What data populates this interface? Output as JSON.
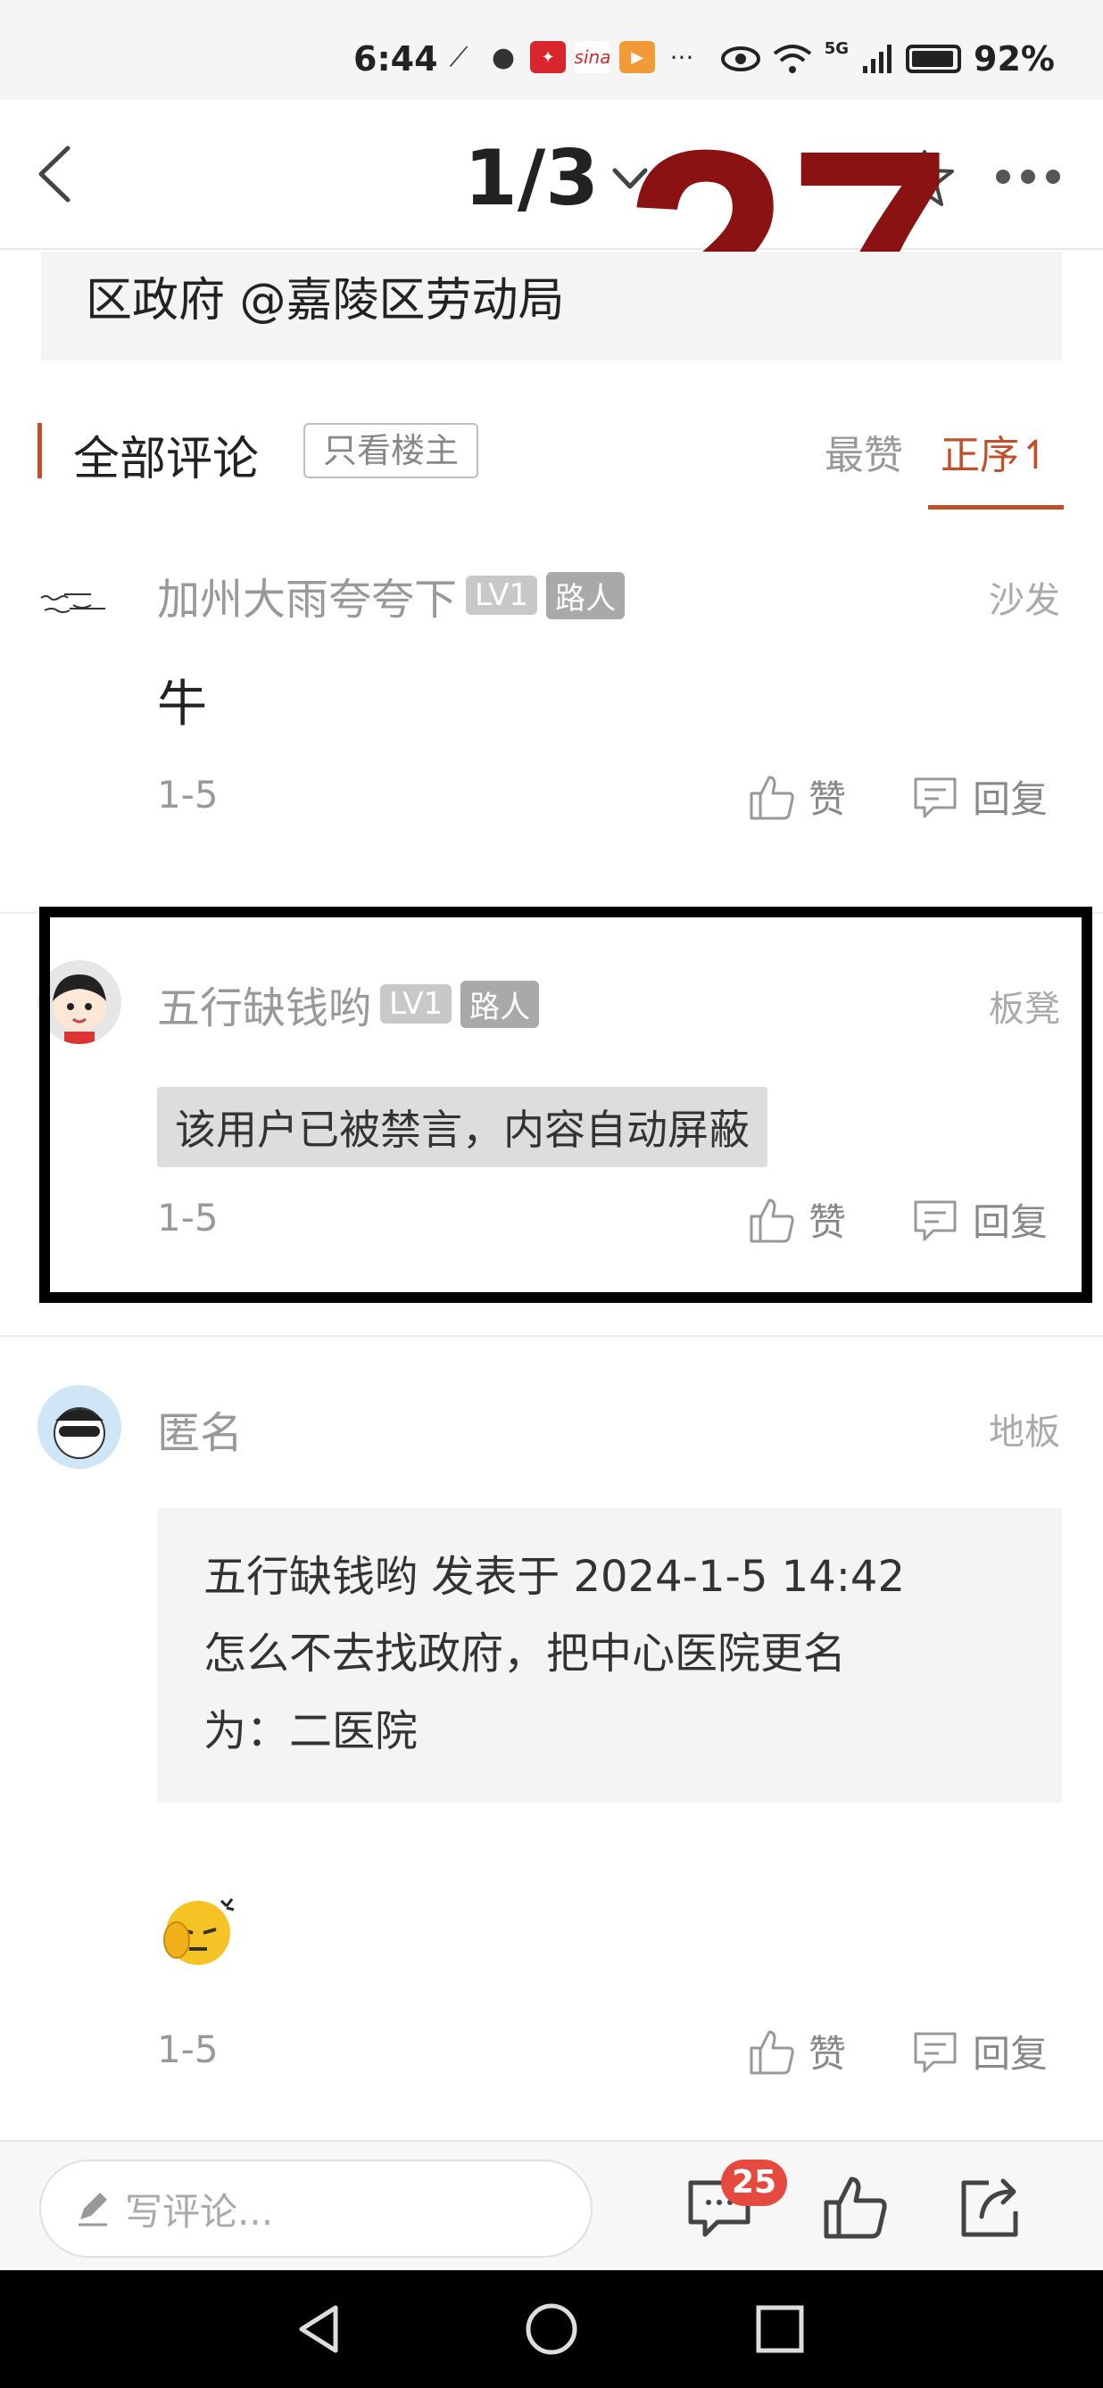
{
  "status_bar": {
    "time": "6:44",
    "network": "5G",
    "battery": "92%"
  },
  "header": {
    "page_indicator": "1/3",
    "overlay_number": "27"
  },
  "post_excerpt": "区政府 @嘉陵区劳动局",
  "comments_header": {
    "title": "全部评论",
    "filter_label": "只看楼主",
    "sort_hot": "最赞",
    "sort_order": "正序↿"
  },
  "comments": [
    {
      "username": "加州大雨夸夸下",
      "level": "LV1",
      "role": "路人",
      "floor": "沙发",
      "content": "牛",
      "date": "1-5",
      "like_label": "赞",
      "reply_label": "回复"
    },
    {
      "username": "五行缺钱哟",
      "level": "LV1",
      "role": "路人",
      "floor": "板凳",
      "content": "该用户已被禁言，内容自动屏蔽",
      "date": "1-5",
      "like_label": "赞",
      "reply_label": "回复"
    },
    {
      "username": "匿名",
      "floor": "地板",
      "quote_line1": "五行缺钱哟 发表于 2024-1-5 14:42",
      "quote_line2": "怎么不去找政府，把中心医院更名",
      "quote_line3": "为：二医院",
      "date": "1-5",
      "like_label": "赞",
      "reply_label": "回复"
    }
  ],
  "bottom_bar": {
    "input_placeholder": "写评论...",
    "comment_count": "25"
  }
}
